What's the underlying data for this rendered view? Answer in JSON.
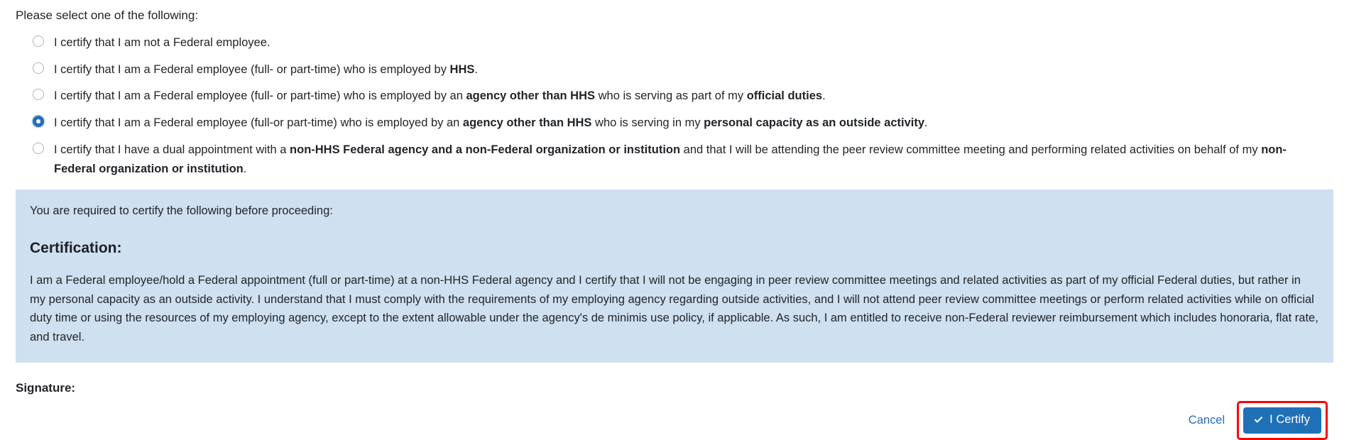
{
  "form": {
    "prompt": "Please select one of the following:",
    "options": [
      {
        "id": "not-federal-employee",
        "selected": false,
        "parts": [
          {
            "text": "I certify that I am not a Federal employee.",
            "bold": false
          }
        ]
      },
      {
        "id": "hhs-employee",
        "selected": false,
        "parts": [
          {
            "text": "I certify that I am a Federal employee (full- or part-time) who is employed by ",
            "bold": false
          },
          {
            "text": "HHS",
            "bold": true
          },
          {
            "text": ".",
            "bold": false
          }
        ]
      },
      {
        "id": "other-agency-official-duties",
        "selected": false,
        "parts": [
          {
            "text": "I certify that I am a Federal employee (full- or part-time) who is employed by an ",
            "bold": false
          },
          {
            "text": "agency other than HHS",
            "bold": true
          },
          {
            "text": " who is serving as part of my ",
            "bold": false
          },
          {
            "text": "official duties",
            "bold": true
          },
          {
            "text": ".",
            "bold": false
          }
        ]
      },
      {
        "id": "other-agency-personal-capacity",
        "selected": true,
        "parts": [
          {
            "text": "I certify that I am a Federal employee (full-or part-time) who is employed by an ",
            "bold": false
          },
          {
            "text": "agency other than HHS",
            "bold": true
          },
          {
            "text": " who is serving in my ",
            "bold": false
          },
          {
            "text": "personal capacity as an outside activity",
            "bold": true
          },
          {
            "text": ".",
            "bold": false
          }
        ]
      },
      {
        "id": "dual-appointment",
        "selected": false,
        "parts": [
          {
            "text": "I certify that I have a dual appointment with a ",
            "bold": false
          },
          {
            "text": "non-HHS Federal agency and a non-Federal organization or institution",
            "bold": true
          },
          {
            "text": " and that I will be attending the peer review committee meeting and performing related activities on behalf of my ",
            "bold": false
          },
          {
            "text": "non-Federal organization or institution",
            "bold": true
          },
          {
            "text": ".",
            "bold": false
          }
        ]
      }
    ]
  },
  "callout": {
    "lead": "You are required to certify the following before proceeding:",
    "heading": "Certification:",
    "body": "I am a Federal employee/hold a Federal appointment (full or part-time) at a non-HHS Federal agency and I certify that I will not be engaging in peer review committee meetings and related activities as part of my official Federal duties, but rather in my personal capacity as an outside activity. I understand that I must comply with the requirements of my employing agency regarding outside activities, and I will not attend peer review committee meetings or perform related activities while on official duty time or using the resources of my employing agency, except to the extent allowable under the agency's de minimis use policy, if applicable. As such, I am entitled to receive non-Federal reviewer reimbursement which includes honoraria, flat rate, and travel.",
    "background_color": "#cfe0f1"
  },
  "signature": {
    "label": "Signature:"
  },
  "actions": {
    "cancel_label": "Cancel",
    "certify_label": "I Certify",
    "certify_icon": "check-icon",
    "certify_background": "#2070b8",
    "highlight_color": "#ff0000",
    "link_color": "#2a6db5"
  }
}
